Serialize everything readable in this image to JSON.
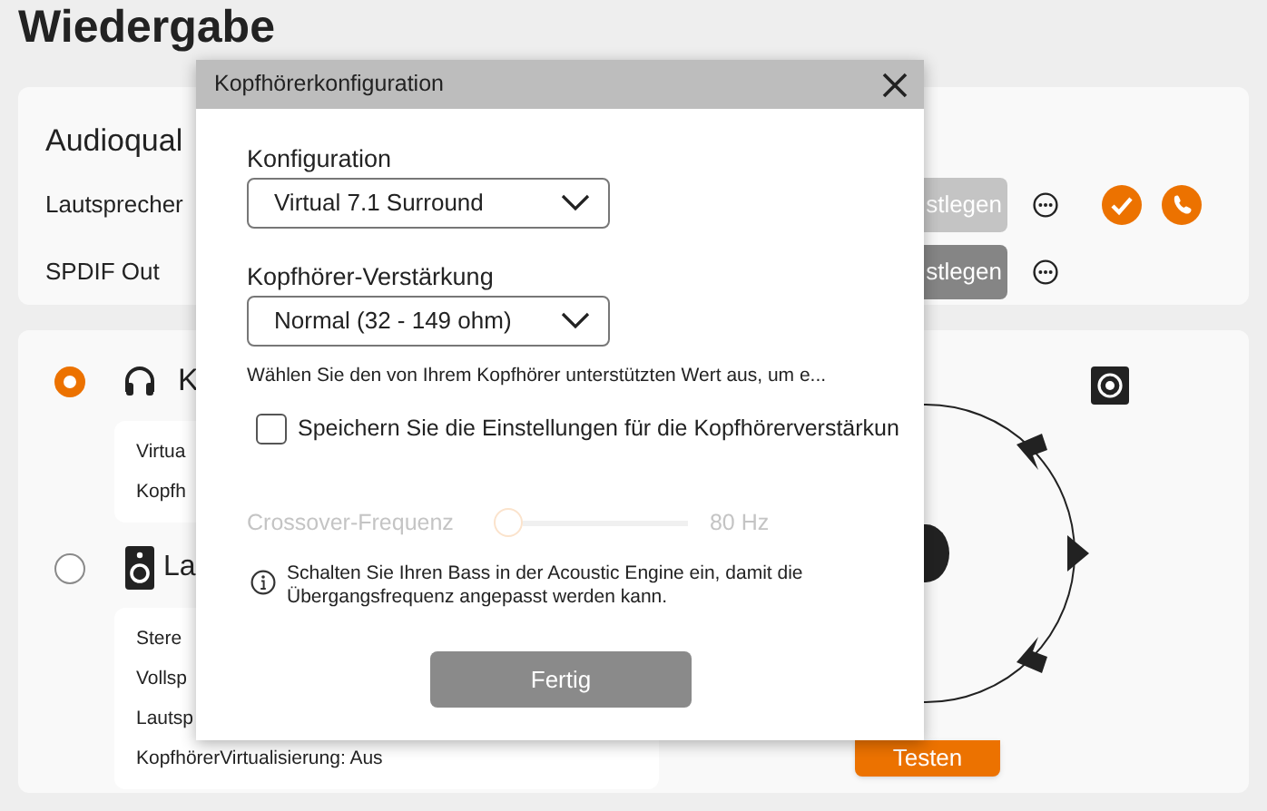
{
  "page_title": "Wiedergabe",
  "audio_quality": {
    "title": "Audioqual",
    "rows": [
      {
        "label": "Lautsprecher",
        "button": "stlegen",
        "disabled": true,
        "status_icons": true
      },
      {
        "label": "SPDIF Out",
        "button": "stlegen",
        "disabled": false,
        "status_icons": false
      }
    ]
  },
  "outputs": [
    {
      "kind": "headphones",
      "label": "K",
      "selected": true,
      "details": [
        "Virtua",
        "Kopfh"
      ]
    },
    {
      "kind": "speakers",
      "label": "La",
      "selected": false,
      "details": [
        "Stere",
        "Vollsp",
        "Lautsp",
        "KopfhörerVirtualisierung: Aus"
      ]
    }
  ],
  "test_button": "Testen",
  "dialog": {
    "title": "Kopfhörerkonfiguration",
    "fields": [
      {
        "label": "Konfiguration",
        "value": "Virtual 7.1 Surround"
      },
      {
        "label": "Kopfhörer-Verstärkung",
        "value": "Normal (32 - 149 ohm)"
      }
    ],
    "hint": "Wählen Sie den von Ihrem Kopfhörer unterstützten Wert aus, um e...",
    "checkbox": {
      "label": "Speichern Sie die Einstellungen für die Kopfhörerverstärkun",
      "checked": false
    },
    "crossover": {
      "label": "Crossover-Frequenz",
      "level": 0,
      "reading": "80 Hz",
      "disabled": true
    },
    "info": "Schalten Sie Ihren Bass in der Acoustic Engine ein, damit die Übergangsfrequenz angepasst werden kann.",
    "button": "Fertig"
  }
}
